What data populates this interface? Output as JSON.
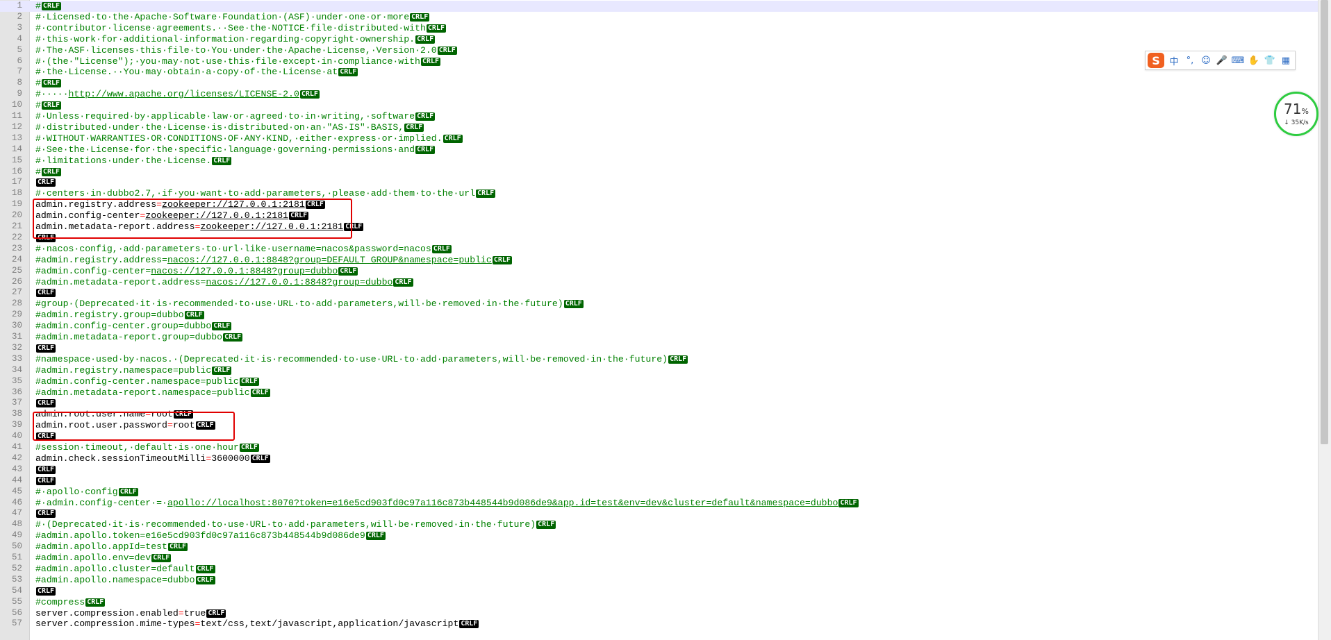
{
  "editor": {
    "eol_marker": "CRLF",
    "current_line": 1,
    "lines": [
      {
        "n": "1",
        "eol": "green",
        "seg": [
          [
            "cm",
            "#"
          ]
        ]
      },
      {
        "n": "2",
        "eol": "green",
        "seg": [
          [
            "cm",
            "#·Licensed·to·the·Apache·Software·Foundation·(ASF)·under·one·or·more"
          ]
        ]
      },
      {
        "n": "3",
        "eol": "green",
        "seg": [
          [
            "cm",
            "#·contributor·license·agreements.··See·the·NOTICE·file·distributed·with"
          ]
        ]
      },
      {
        "n": "4",
        "eol": "green",
        "seg": [
          [
            "cm",
            "#·this·work·for·additional·information·regarding·copyright·ownership."
          ]
        ]
      },
      {
        "n": "5",
        "eol": "green",
        "seg": [
          [
            "cm",
            "#·The·ASF·licenses·this·file·to·You·under·the·Apache·License,·Version·2.0"
          ]
        ]
      },
      {
        "n": "6",
        "eol": "green",
        "seg": [
          [
            "cm",
            "#·(the·\"License\");·you·may·not·use·this·file·except·in·compliance·with"
          ]
        ]
      },
      {
        "n": "7",
        "eol": "green",
        "seg": [
          [
            "cm",
            "#·the·License.··You·may·obtain·a·copy·of·the·License·at"
          ]
        ]
      },
      {
        "n": "8",
        "eol": "green",
        "seg": [
          [
            "cm",
            "#"
          ]
        ]
      },
      {
        "n": "9",
        "eol": "green",
        "seg": [
          [
            "cm",
            "#·····"
          ],
          [
            "cm ul",
            "http://www.apache.org/licenses/LICENSE-2.0"
          ]
        ]
      },
      {
        "n": "10",
        "eol": "green",
        "seg": [
          [
            "cm",
            "#"
          ]
        ]
      },
      {
        "n": "11",
        "eol": "green",
        "seg": [
          [
            "cm",
            "#·Unless·required·by·applicable·law·or·agreed·to·in·writing,·software"
          ]
        ]
      },
      {
        "n": "12",
        "eol": "green",
        "seg": [
          [
            "cm",
            "#·distributed·under·the·License·is·distributed·on·an·\"AS·IS\"·BASIS,"
          ]
        ]
      },
      {
        "n": "13",
        "eol": "green",
        "seg": [
          [
            "cm",
            "#·WITHOUT·WARRANTIES·OR·CONDITIONS·OF·ANY·KIND,·either·express·or·implied."
          ]
        ]
      },
      {
        "n": "14",
        "eol": "green",
        "seg": [
          [
            "cm",
            "#·See·the·License·for·the·specific·language·governing·permissions·and"
          ]
        ]
      },
      {
        "n": "15",
        "eol": "green",
        "seg": [
          [
            "cm",
            "#·limitations·under·the·License."
          ]
        ]
      },
      {
        "n": "16",
        "eol": "green",
        "seg": [
          [
            "cm",
            "#"
          ]
        ]
      },
      {
        "n": "17",
        "eol": "black",
        "seg": []
      },
      {
        "n": "18",
        "eol": "green",
        "seg": [
          [
            "cm",
            "#·centers·in·dubbo2.7,·if·you·want·to·add·parameters,·please·add·them·to·the·url"
          ]
        ]
      },
      {
        "n": "19",
        "eol": "black",
        "seg": [
          [
            "ky",
            "admin.registry.address"
          ],
          [
            "op",
            "="
          ],
          [
            "vl ul",
            "zookeeper://127.0.0.1:2181"
          ]
        ]
      },
      {
        "n": "20",
        "eol": "black",
        "seg": [
          [
            "ky",
            "admin.config-center"
          ],
          [
            "op",
            "="
          ],
          [
            "vl ul",
            "zookeeper://127.0.0.1:2181"
          ]
        ]
      },
      {
        "n": "21",
        "eol": "black",
        "seg": [
          [
            "ky",
            "admin.metadata-report.address"
          ],
          [
            "op",
            "="
          ],
          [
            "vl ul",
            "zookeeper://127.0.0.1:2181"
          ]
        ]
      },
      {
        "n": "22",
        "eol": "black",
        "seg": []
      },
      {
        "n": "23",
        "eol": "green",
        "seg": [
          [
            "cm",
            "#·nacos·config,·add·parameters·to·url·like·username=nacos&password=nacos"
          ]
        ]
      },
      {
        "n": "24",
        "eol": "green",
        "seg": [
          [
            "cm",
            "#admin.registry.address="
          ],
          [
            "cm ul",
            "nacos://127.0.0.1:8848?group=DEFAULT_GROUP&namespace=public"
          ]
        ]
      },
      {
        "n": "25",
        "eol": "green",
        "seg": [
          [
            "cm",
            "#admin.config-center="
          ],
          [
            "cm ul",
            "nacos://127.0.0.1:8848?group=dubbo"
          ]
        ]
      },
      {
        "n": "26",
        "eol": "green",
        "seg": [
          [
            "cm",
            "#admin.metadata-report.address="
          ],
          [
            "cm ul",
            "nacos://127.0.0.1:8848?group=dubbo"
          ]
        ]
      },
      {
        "n": "27",
        "eol": "black",
        "seg": []
      },
      {
        "n": "28",
        "eol": "green",
        "seg": [
          [
            "cm",
            "#group·(Deprecated·it·is·recommended·to·use·URL·to·add·parameters,will·be·removed·in·the·future)"
          ]
        ]
      },
      {
        "n": "29",
        "eol": "green",
        "seg": [
          [
            "cm",
            "#admin.registry.group=dubbo"
          ]
        ]
      },
      {
        "n": "30",
        "eol": "green",
        "seg": [
          [
            "cm",
            "#admin.config-center.group=dubbo"
          ]
        ]
      },
      {
        "n": "31",
        "eol": "green",
        "seg": [
          [
            "cm",
            "#admin.metadata-report.group=dubbo"
          ]
        ]
      },
      {
        "n": "32",
        "eol": "black",
        "seg": []
      },
      {
        "n": "33",
        "eol": "green",
        "seg": [
          [
            "cm",
            "#namespace·used·by·nacos.·(Deprecated·it·is·recommended·to·use·URL·to·add·parameters,will·be·removed·in·the·future)"
          ]
        ]
      },
      {
        "n": "34",
        "eol": "green",
        "seg": [
          [
            "cm",
            "#admin.registry.namespace=public"
          ]
        ]
      },
      {
        "n": "35",
        "eol": "green",
        "seg": [
          [
            "cm",
            "#admin.config-center.namespace=public"
          ]
        ]
      },
      {
        "n": "36",
        "eol": "green",
        "seg": [
          [
            "cm",
            "#admin.metadata-report.namespace=public"
          ]
        ]
      },
      {
        "n": "37",
        "eol": "black",
        "seg": []
      },
      {
        "n": "38",
        "eol": "black",
        "seg": [
          [
            "ky",
            "admin.root.user.name"
          ],
          [
            "op",
            "="
          ],
          [
            "vl",
            "root"
          ]
        ]
      },
      {
        "n": "39",
        "eol": "black",
        "seg": [
          [
            "ky",
            "admin.root.user.password"
          ],
          [
            "op",
            "="
          ],
          [
            "vl",
            "root"
          ]
        ]
      },
      {
        "n": "40",
        "eol": "black",
        "seg": []
      },
      {
        "n": "41",
        "eol": "green",
        "seg": [
          [
            "cm",
            "#session·timeout,·default·is·one·hour"
          ]
        ]
      },
      {
        "n": "42",
        "eol": "black",
        "seg": [
          [
            "ky",
            "admin.check.sessionTimeoutMilli"
          ],
          [
            "op",
            "="
          ],
          [
            "vl",
            "3600000"
          ]
        ]
      },
      {
        "n": "43",
        "eol": "black",
        "seg": []
      },
      {
        "n": "44",
        "eol": "black",
        "seg": []
      },
      {
        "n": "45",
        "eol": "green",
        "seg": [
          [
            "cm",
            "#·apollo·config"
          ]
        ]
      },
      {
        "n": "46",
        "eol": "green",
        "seg": [
          [
            "cm",
            "#·admin.config-center·=·"
          ],
          [
            "cm ul",
            "apollo://localhost:8070?token=e16e5cd903fd0c97a116c873b448544b9d086de9&app.id=test&env=dev&cluster=default&namespace=dubbo"
          ]
        ]
      },
      {
        "n": "47",
        "eol": "black",
        "seg": []
      },
      {
        "n": "48",
        "eol": "green",
        "seg": [
          [
            "cm",
            "#·(Deprecated·it·is·recommended·to·use·URL·to·add·parameters,will·be·removed·in·the·future)"
          ]
        ]
      },
      {
        "n": "49",
        "eol": "green",
        "seg": [
          [
            "cm",
            "#admin.apollo.token=e16e5cd903fd0c97a116c873b448544b9d086de9"
          ]
        ]
      },
      {
        "n": "50",
        "eol": "green",
        "seg": [
          [
            "cm",
            "#admin.apollo.appId=test"
          ]
        ]
      },
      {
        "n": "51",
        "eol": "green",
        "seg": [
          [
            "cm",
            "#admin.apollo.env=dev"
          ]
        ]
      },
      {
        "n": "52",
        "eol": "green",
        "seg": [
          [
            "cm",
            "#admin.apollo.cluster=default"
          ]
        ]
      },
      {
        "n": "53",
        "eol": "green",
        "seg": [
          [
            "cm",
            "#admin.apollo.namespace=dubbo"
          ]
        ]
      },
      {
        "n": "54",
        "eol": "black",
        "seg": []
      },
      {
        "n": "55",
        "eol": "green",
        "seg": [
          [
            "cm",
            "#compress"
          ]
        ]
      },
      {
        "n": "56",
        "eol": "black",
        "seg": [
          [
            "ky",
            "server.compression.enabled"
          ],
          [
            "op",
            "="
          ],
          [
            "vl",
            "true"
          ]
        ]
      },
      {
        "n": "57",
        "eol": "black",
        "seg": [
          [
            "ky",
            "server.compression.mime-types"
          ],
          [
            "op",
            "="
          ],
          [
            "vl",
            "text/css,text/javascript,application/javascript"
          ]
        ]
      }
    ]
  },
  "colors": {
    "comment": "#008000",
    "operator": "#ff0000",
    "eol_green": "#006400",
    "eol_black": "#000000",
    "highlight_box": "#e00000"
  },
  "ime_toolbar": {
    "logo": "S",
    "buttons": [
      {
        "name": "chinese-mode-button",
        "glyph": "中"
      },
      {
        "name": "punctuation-button",
        "glyph": "°,"
      },
      {
        "name": "emoji-button",
        "glyph": "☺"
      },
      {
        "name": "voice-input-button",
        "glyph": "🎤"
      },
      {
        "name": "keyboard-button",
        "glyph": "⌨"
      },
      {
        "name": "handwriting-button",
        "glyph": "✋"
      },
      {
        "name": "skin-button",
        "glyph": "👕"
      },
      {
        "name": "toolbox-button",
        "glyph": "▦"
      }
    ]
  },
  "speed_widget": {
    "percent": "71",
    "percent_sign": "%",
    "rate": "↓ 35K/s"
  }
}
